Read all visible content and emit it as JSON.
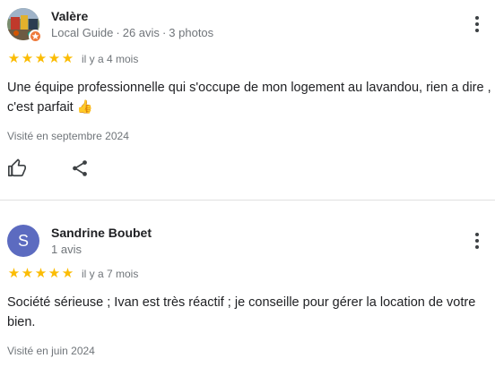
{
  "reviews": [
    {
      "author": "Valère",
      "meta_role": "Local Guide",
      "meta_reviews": "26 avis",
      "meta_photos": "3 photos",
      "separator": "·",
      "stars": "★★★★★",
      "rating": 5,
      "time_ago": "il y a 4 mois",
      "text": "Une équipe professionnelle qui s'occupe de mon logement au lavandou, rien a dire , c'est parfait 👍",
      "visited": "Visité en septembre 2024"
    },
    {
      "author": "Sandrine Boubet",
      "avatar_letter": "S",
      "meta_reviews": "1 avis",
      "stars": "★★★★★",
      "rating": 5,
      "time_ago": "il y a 7 mois",
      "text": "Société sérieuse ; Ivan est très réactif ; je conseille pour gérer la location de votre bien.",
      "visited": "Visité en juin 2024"
    }
  ],
  "icons": {
    "like": "thumbs-up-icon",
    "share": "share-icon",
    "menu": "more-vert-icon",
    "star": "star-icon"
  },
  "colors": {
    "star": "#fbbc04",
    "avatar_letter_bg": "#5c6bc0",
    "local_guide_badge": "#ee7a3b",
    "meta_text": "#70757a"
  }
}
